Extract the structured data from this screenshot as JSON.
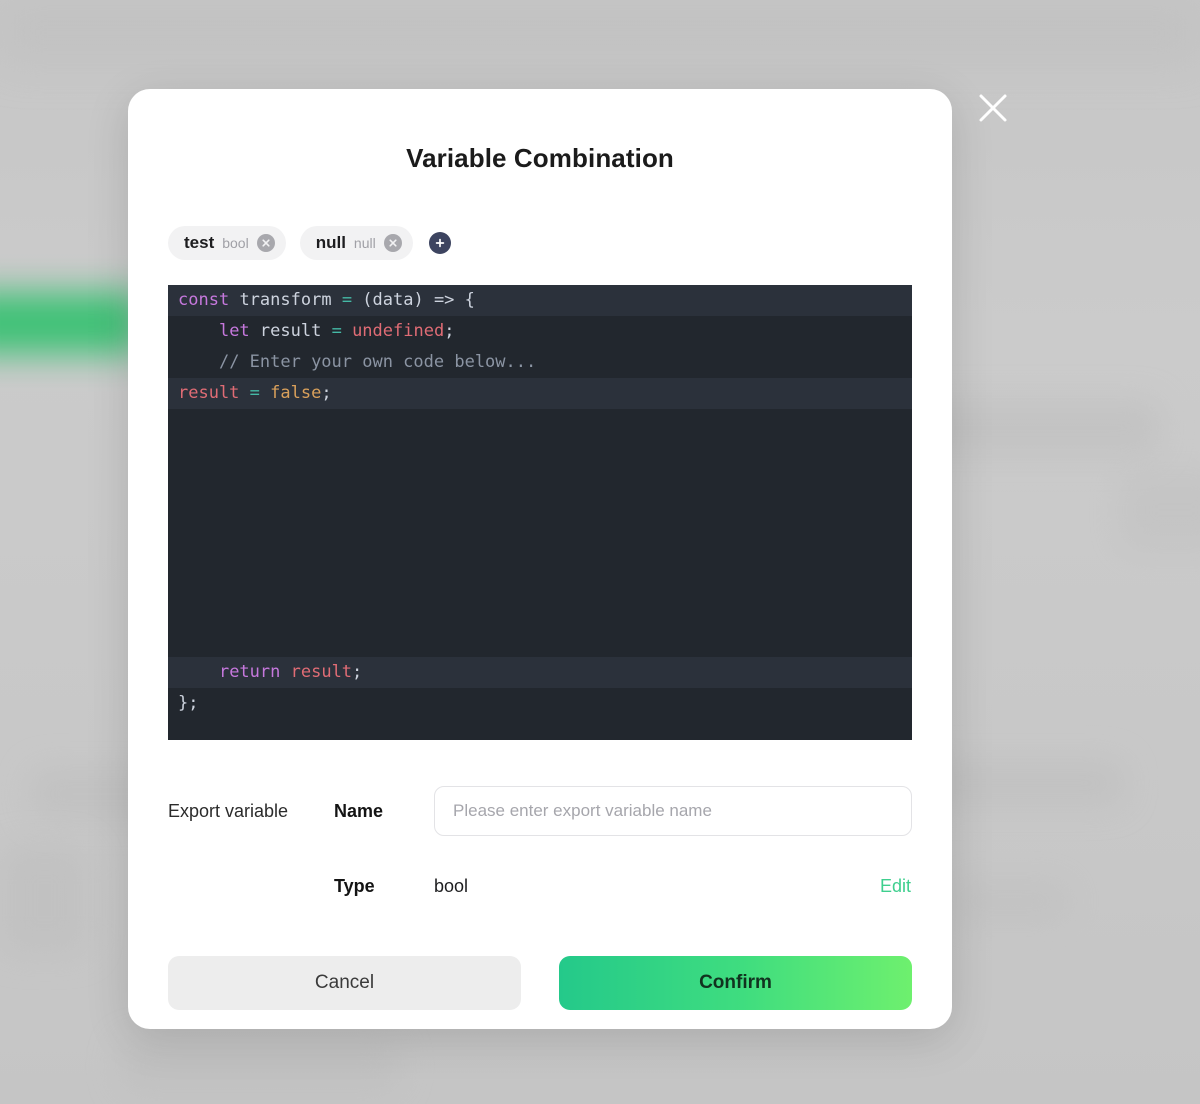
{
  "dialog": {
    "title": "Variable Combination",
    "close_icon": "close-icon"
  },
  "variables": {
    "tags": [
      {
        "name": "test",
        "type": "bool",
        "remove_icon": "close-circle-icon"
      },
      {
        "name": "null",
        "type": "null",
        "remove_icon": "close-circle-icon"
      }
    ],
    "add_button_icon": "plus-circle-icon"
  },
  "editor": {
    "lines": [
      {
        "readonly": true,
        "tokens": [
          {
            "t": "const",
            "c": "kw"
          },
          {
            "t": " ",
            "c": "plain"
          },
          {
            "t": "transform",
            "c": "plain"
          },
          {
            "t": " ",
            "c": "plain"
          },
          {
            "t": "=",
            "c": "op"
          },
          {
            "t": " (data) => {",
            "c": "plain"
          }
        ]
      },
      {
        "readonly": false,
        "tokens": [
          {
            "t": "    ",
            "c": "plain"
          },
          {
            "t": "let",
            "c": "kw2"
          },
          {
            "t": " result ",
            "c": "plain"
          },
          {
            "t": "=",
            "c": "op"
          },
          {
            "t": " ",
            "c": "plain"
          },
          {
            "t": "undefined",
            "c": "const"
          },
          {
            "t": ";",
            "c": "plain"
          }
        ]
      },
      {
        "readonly": false,
        "tokens": [
          {
            "t": "    ",
            "c": "plain"
          },
          {
            "t": "// Enter your own code below...",
            "c": "comment"
          }
        ]
      },
      {
        "readonly": true,
        "tokens": [
          {
            "t": "result",
            "c": "var"
          },
          {
            "t": " ",
            "c": "plain"
          },
          {
            "t": "=",
            "c": "op"
          },
          {
            "t": " ",
            "c": "plain"
          },
          {
            "t": "false",
            "c": "lit"
          },
          {
            "t": ";",
            "c": "plain"
          }
        ]
      }
    ],
    "blank_line_count": 8,
    "tail_lines": [
      {
        "readonly": true,
        "tokens": [
          {
            "t": "    ",
            "c": "plain"
          },
          {
            "t": "return",
            "c": "kw"
          },
          {
            "t": " ",
            "c": "plain"
          },
          {
            "t": "result",
            "c": "var"
          },
          {
            "t": ";",
            "c": "plain"
          }
        ]
      },
      {
        "readonly": false,
        "tokens": [
          {
            "t": "};",
            "c": "plain"
          }
        ]
      }
    ]
  },
  "export": {
    "section_label": "Export variable",
    "name_label": "Name",
    "name_value": "",
    "name_placeholder": "Please enter export variable name",
    "type_label": "Type",
    "type_value": "bool",
    "edit_label": "Edit"
  },
  "footer": {
    "cancel_label": "Cancel",
    "confirm_label": "Confirm"
  },
  "colors": {
    "accent_green": "#3ecf8e",
    "confirm_gradient_start": "#24c98a",
    "confirm_gradient_end": "#6ef06e",
    "editor_bg": "#22272e",
    "editor_readonly_bg": "#2b313b",
    "add_button_bg": "#3d4460"
  }
}
